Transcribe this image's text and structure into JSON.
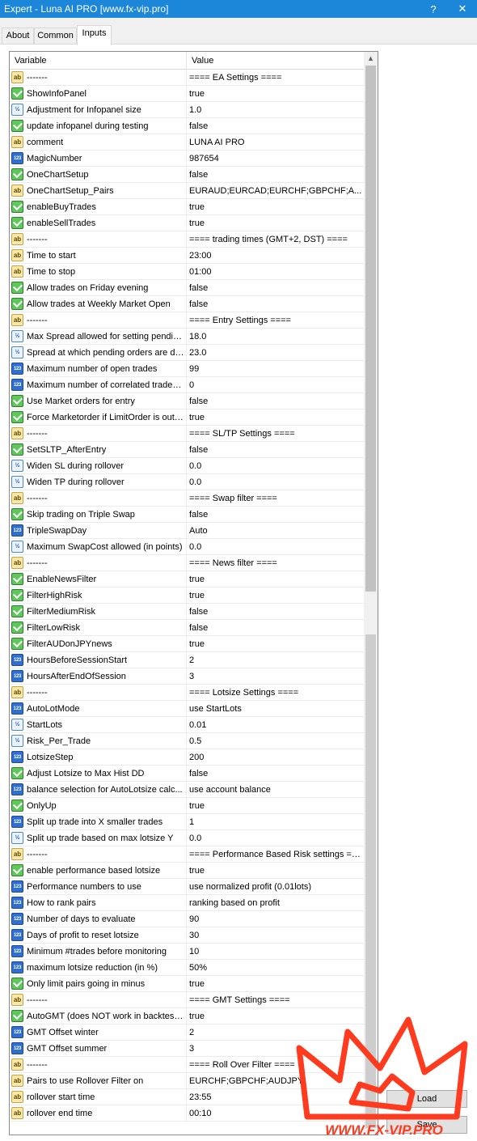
{
  "window": {
    "title": "Expert - Luna AI PRO [www.fx-vip.pro]",
    "help_label": "?",
    "close_label": "✕"
  },
  "tabs": [
    {
      "label": "About",
      "active": false
    },
    {
      "label": "Common",
      "active": false
    },
    {
      "label": "Inputs",
      "active": true
    }
  ],
  "grid": {
    "headers": {
      "variable": "Variable",
      "value": "Value"
    },
    "rows": [
      {
        "type": "ab",
        "variable": "-------",
        "value": "==== EA Settings ===="
      },
      {
        "type": "bool",
        "variable": "ShowInfoPanel",
        "value": "true"
      },
      {
        "type": "dbl",
        "variable": "Adjustment for Infopanel size",
        "value": "1.0"
      },
      {
        "type": "bool",
        "variable": "update infopanel during testing",
        "value": "false"
      },
      {
        "type": "ab",
        "variable": "comment",
        "value": "LUNA AI PRO"
      },
      {
        "type": "num",
        "variable": "MagicNumber",
        "value": "987654"
      },
      {
        "type": "bool",
        "variable": "OneChartSetup",
        "value": "false"
      },
      {
        "type": "ab",
        "variable": "OneChartSetup_Pairs",
        "value": "EURAUD;EURCAD;EURCHF;GBPCHF;A..."
      },
      {
        "type": "bool",
        "variable": "enableBuyTrades",
        "value": "true"
      },
      {
        "type": "bool",
        "variable": "enableSellTrades",
        "value": "true"
      },
      {
        "type": "ab",
        "variable": "-------",
        "value": "==== trading times (GMT+2, DST) ===="
      },
      {
        "type": "ab",
        "variable": "Time to start",
        "value": "23:00"
      },
      {
        "type": "ab",
        "variable": "Time to stop",
        "value": "01:00"
      },
      {
        "type": "bool",
        "variable": "Allow trades on Friday evening",
        "value": "false"
      },
      {
        "type": "bool",
        "variable": "Allow trades at Weekly Market Open",
        "value": "false"
      },
      {
        "type": "ab",
        "variable": "-------",
        "value": "==== Entry Settings ===="
      },
      {
        "type": "dbl",
        "variable": "Max Spread allowed for setting pendin...",
        "value": "18.0"
      },
      {
        "type": "dbl",
        "variable": "Spread at which pending orders are de...",
        "value": "23.0"
      },
      {
        "type": "num",
        "variable": "Maximum number of open trades",
        "value": "99"
      },
      {
        "type": "num",
        "variable": "Maximum number of correlated trades (...",
        "value": "0"
      },
      {
        "type": "bool",
        "variable": "Use Market orders for entry",
        "value": "false"
      },
      {
        "type": "bool",
        "variable": "Force Marketorder if LimitOrder is out o...",
        "value": "true"
      },
      {
        "type": "ab",
        "variable": "-------",
        "value": "==== SL/TP Settings ===="
      },
      {
        "type": "bool",
        "variable": "SetSLTP_AfterEntry",
        "value": "false"
      },
      {
        "type": "dbl",
        "variable": "Widen SL during rollover",
        "value": "0.0"
      },
      {
        "type": "dbl",
        "variable": "Widen TP during rollover",
        "value": "0.0"
      },
      {
        "type": "ab",
        "variable": "-------",
        "value": "==== Swap filter ===="
      },
      {
        "type": "bool",
        "variable": "Skip trading on Triple Swap",
        "value": "false"
      },
      {
        "type": "enum",
        "variable": "TripleSwapDay",
        "value": "Auto"
      },
      {
        "type": "dbl",
        "variable": "Maximum SwapCost allowed (in points)",
        "value": "0.0"
      },
      {
        "type": "ab",
        "variable": "-------",
        "value": "==== News filter ===="
      },
      {
        "type": "bool",
        "variable": "EnableNewsFilter",
        "value": "true"
      },
      {
        "type": "bool",
        "variable": "FilterHighRisk",
        "value": "true"
      },
      {
        "type": "bool",
        "variable": "FilterMediumRisk",
        "value": "false"
      },
      {
        "type": "bool",
        "variable": "FilterLowRisk",
        "value": "false"
      },
      {
        "type": "bool",
        "variable": "FilterAUDonJPYnews",
        "value": "true"
      },
      {
        "type": "num",
        "variable": "HoursBeforeSessionStart",
        "value": "2"
      },
      {
        "type": "num",
        "variable": "HoursAfterEndOfSession",
        "value": "3"
      },
      {
        "type": "ab",
        "variable": "-------",
        "value": "==== Lotsize Settings ===="
      },
      {
        "type": "enum",
        "variable": "AutoLotMode",
        "value": "use StartLots"
      },
      {
        "type": "dbl",
        "variable": "StartLots",
        "value": "0.01"
      },
      {
        "type": "dbl",
        "variable": "Risk_Per_Trade",
        "value": "0.5"
      },
      {
        "type": "num",
        "variable": "LotsizeStep",
        "value": "200"
      },
      {
        "type": "bool",
        "variable": "Adjust Lotsize to Max Hist DD",
        "value": "false"
      },
      {
        "type": "enum",
        "variable": "balance selection for AutoLotsize calc...",
        "value": "use account balance"
      },
      {
        "type": "bool",
        "variable": "OnlyUp",
        "value": "true"
      },
      {
        "type": "num",
        "variable": "Split up trade into X smaller trades",
        "value": "1"
      },
      {
        "type": "dbl",
        "variable": "Split up trade based on max lotsize Y",
        "value": "0.0"
      },
      {
        "type": "ab",
        "variable": "-------",
        "value": "==== Performance Based Risk settings ===="
      },
      {
        "type": "bool",
        "variable": "enable performance based lotsize",
        "value": "true"
      },
      {
        "type": "enum",
        "variable": "Performance numbers to use",
        "value": "use normalized profit (0.01lots)"
      },
      {
        "type": "enum",
        "variable": "How to rank pairs",
        "value": "ranking based on profit"
      },
      {
        "type": "num",
        "variable": "Number of days to evaluate",
        "value": "90"
      },
      {
        "type": "num",
        "variable": "Days of profit to reset lotsize",
        "value": "30"
      },
      {
        "type": "num",
        "variable": "Minimum #trades before monitoring",
        "value": "10"
      },
      {
        "type": "enum",
        "variable": "maximum lotsize reduction (in %)",
        "value": "50%"
      },
      {
        "type": "bool",
        "variable": "Only limit pairs going in minus",
        "value": "true"
      },
      {
        "type": "ab",
        "variable": "-------",
        "value": "==== GMT Settings ===="
      },
      {
        "type": "bool",
        "variable": "AutoGMT (does NOT work in backtesti...",
        "value": "true"
      },
      {
        "type": "num",
        "variable": "GMT Offset winter",
        "value": "2"
      },
      {
        "type": "num",
        "variable": "GMT Offset summer",
        "value": "3"
      },
      {
        "type": "ab",
        "variable": "-------",
        "value": "==== Roll Over Filter ===="
      },
      {
        "type": "ab",
        "variable": "Pairs to use Rollover Filter on",
        "value": "EURCHF;GBPCHF;AUDJPY;"
      },
      {
        "type": "ab",
        "variable": "rollover start time",
        "value": "23:55"
      },
      {
        "type": "ab",
        "variable": "rollover end time",
        "value": "00:10"
      }
    ]
  },
  "icon_glyphs": {
    "ab": "ab",
    "num": "123",
    "dbl": "½",
    "enum": "123"
  },
  "side_buttons": [
    {
      "label": "Load"
    },
    {
      "label": "Save"
    }
  ],
  "watermark": {
    "text": "WWW.FX-VIP.PRO",
    "color": "#ff3b1f"
  }
}
